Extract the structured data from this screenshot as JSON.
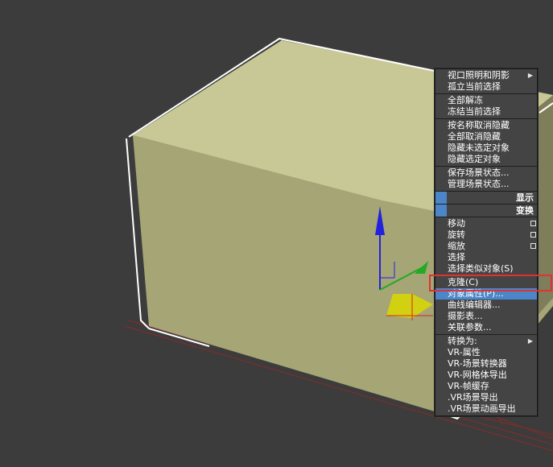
{
  "menu": {
    "groups": [
      {
        "items": [
          {
            "label": "视口照明和阴影",
            "submenu": true
          },
          {
            "label": "孤立当前选择"
          }
        ]
      },
      {
        "items": [
          {
            "label": "全部解冻"
          },
          {
            "label": "冻结当前选择"
          }
        ]
      },
      {
        "items": [
          {
            "label": "按名称取消隐藏"
          },
          {
            "label": "全部取消隐藏"
          },
          {
            "label": "隐藏未选定对象"
          },
          {
            "label": "隐藏选定对象"
          }
        ]
      },
      {
        "items": [
          {
            "label": "保存场景状态..."
          },
          {
            "label": "管理场景状态..."
          }
        ]
      }
    ],
    "headers": {
      "display": "显示",
      "transform": "变换"
    },
    "transform_items": [
      {
        "label": "移动",
        "options": true
      },
      {
        "label": "旋转",
        "options": true
      },
      {
        "label": "缩放",
        "options": true
      },
      {
        "label": "选择"
      },
      {
        "label": "选择类似对象(S)"
      }
    ],
    "tool_items": [
      {
        "label": "克隆(C)"
      },
      {
        "label": "对象属性(P)...",
        "highlighted": true
      },
      {
        "label": "曲线编辑器..."
      },
      {
        "label": "摄影表..."
      },
      {
        "label": "关联参数..."
      }
    ],
    "convert_items": [
      {
        "label": "转换为:",
        "submenu": true
      },
      {
        "label": "VR-属性"
      },
      {
        "label": "VR-场景转换器"
      },
      {
        "label": "VR-网格体导出"
      },
      {
        "label": "VR-帧缓存"
      },
      {
        "label": ".VR场景导出"
      },
      {
        "label": ".VR场景动画导出"
      }
    ]
  },
  "colors": {
    "viewport_bg": "#3c3c3c",
    "box_top": "#c8c896",
    "box_front": "#a5a576",
    "highlight": "#4a86c8",
    "annotation": "#e03232"
  }
}
